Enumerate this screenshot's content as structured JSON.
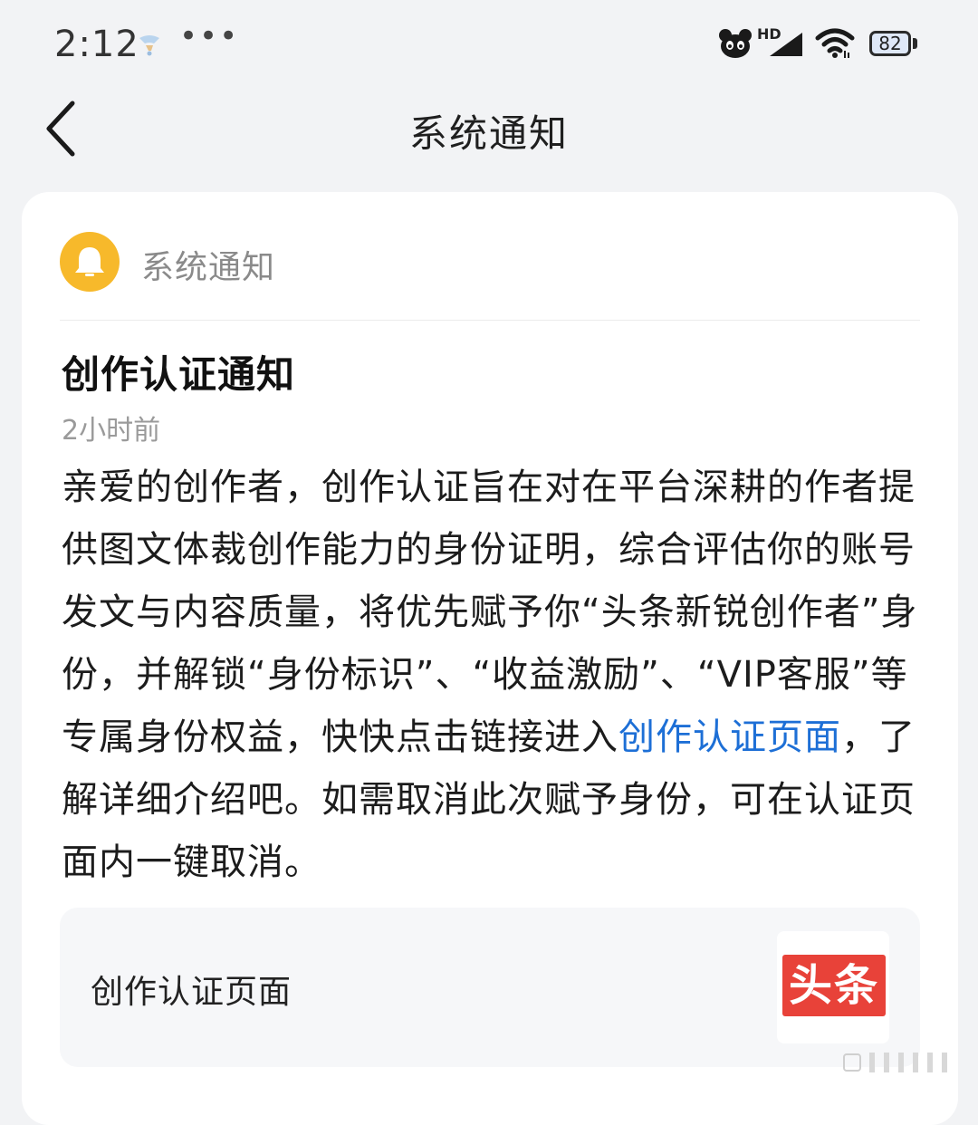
{
  "status_bar": {
    "time": "2:12",
    "more_indicator": "•••",
    "network_label": "HD",
    "battery_level": "82",
    "icons": [
      "weather-icon",
      "pet-app-icon",
      "signal-icon",
      "wifi-icon",
      "battery-icon"
    ]
  },
  "nav": {
    "title": "系统通知",
    "back_icon": "chevron-left-icon"
  },
  "notification": {
    "sender": "系统通知",
    "sender_icon": "bell-icon",
    "title": "创作认证通知",
    "time": "2小时前",
    "body_part1": "亲爱的创作者，创作认证旨在对在平台深耕的作者提供图文体裁创作能力的身份证明，综合评估你的账号发文与内容质量，将优先赋予你“头条新锐创作者”身份，并解锁“身份标识”、“收益激励”、“VIP客服”等专属身份权益，快快点击链接进入",
    "body_link": "创作认证页面",
    "body_part2": "，了解详细介绍吧。如需取消此次赋予身份，可在认证页面内一键取消。",
    "link_card": {
      "title": "创作认证页面",
      "thumb_text": "头条"
    }
  },
  "colors": {
    "page_bg": "#f2f3f5",
    "card_bg": "#ffffff",
    "bell_avatar": "#f7b92b",
    "link": "#1d6fd6",
    "toutiao_red": "#e84239",
    "battery_fill": "#dfe8f7"
  }
}
